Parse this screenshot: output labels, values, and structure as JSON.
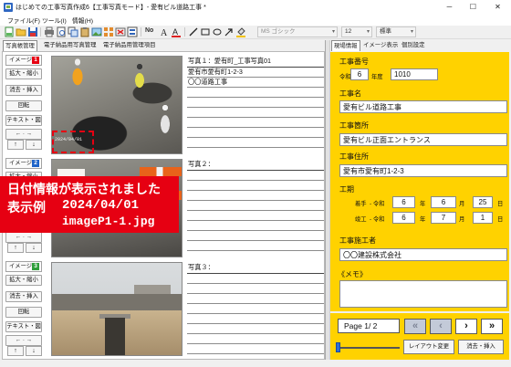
{
  "window": {
    "title": "はじめての工事写真作成6【工事写真モード】- 愛有ビル道路工事 *",
    "minimize_icon": "─",
    "maximize_icon": "☐",
    "close_icon": "✕"
  },
  "menu": {
    "file": "ファイル(F)",
    "tools": "ツール(I)",
    "info": "情報(H)"
  },
  "toolbar": {
    "icons": [
      "new-file-icon",
      "open-folder-icon",
      "save-icon",
      "print-icon",
      "print-preview-icon",
      "copy-photo-icon",
      "paste-photo-icon",
      "add-image-icon",
      "image-list-icon",
      "delete-photo-icon",
      "font-a-icon",
      "font-a-color-icon",
      "line-icon",
      "rectangle-icon",
      "ellipse-icon",
      "arrow-shape-icon"
    ],
    "number_label": "No",
    "font_name": "MS ゴシック",
    "font_size": "12",
    "font_style": "標準",
    "dropdown_icon": "▾"
  },
  "left_tabs": {
    "album": "写真帳管理",
    "electronic_photo": "電子納品用写真管理",
    "electronic_items": "電子納品用管理項目"
  },
  "row_buttons": {
    "image_label": "イメージ",
    "zoom": "拡大・縮小",
    "erase_insert": "消去・挿入",
    "rotate": "回転",
    "text_figure": "テキスト・図",
    "prev_next": "← · →",
    "up": "↑",
    "down": "↓"
  },
  "photo_rows": [
    {
      "number": "1",
      "number_color": "#e60012",
      "caption_title": "写真１：愛有町_工事写真01",
      "caption_lines": [
        "愛有市愛有町1-2-3",
        "〇〇道路工事"
      ],
      "date_stamp": "2024/04/01"
    },
    {
      "number": "2",
      "number_color": "#1e63c8",
      "caption_title": "写真２："
    },
    {
      "number": "3",
      "number_color": "#2e9e3a",
      "caption_title": "写真３："
    }
  ],
  "callout": {
    "message": "日付情報が表示されました",
    "example_label": "表示例",
    "example_date": "2024/04/01",
    "example_file": "imageP1-1.jpg",
    "color": "#e60012"
  },
  "right_tabs": {
    "site_info": "現場情報",
    "image_display": "イメージ表示",
    "individual_settings": "個別設定"
  },
  "site_info": {
    "project_no_label": "工事番号",
    "era": "令和",
    "year": "6",
    "year_suffix": "年度",
    "project_no": "1010",
    "project_name_label": "工事名",
    "project_name": "愛有ビル道路工事",
    "location_label": "工事箇所",
    "location": "愛有ビル正面エントランス",
    "address_label": "工事住所",
    "address": "愛有市愛有町1-2-3",
    "period_label": "工期",
    "start": {
      "label": "着手",
      "era": "- 令和",
      "year": "6",
      "month": "6",
      "day": "25"
    },
    "end": {
      "label": "竣工",
      "era": "- 令和",
      "year": "6",
      "month": "7",
      "day": "1"
    },
    "year_unit": "年",
    "month_unit": "月",
    "day_unit": "日",
    "contractor_label": "工事施工者",
    "contractor": "〇〇建設株式会社",
    "memo_label": "《メモ》",
    "memo": ""
  },
  "navigator": {
    "page_text": "Page 1/ 2",
    "first_icon": "«",
    "prev_icon": "‹",
    "next_icon": "›",
    "last_icon": "»",
    "layout_button": "レイアウト変更",
    "erase_insert_button": "消去・挿入"
  },
  "colors": {
    "panel_yellow": "#ffd200",
    "accent_red": "#e60012"
  }
}
